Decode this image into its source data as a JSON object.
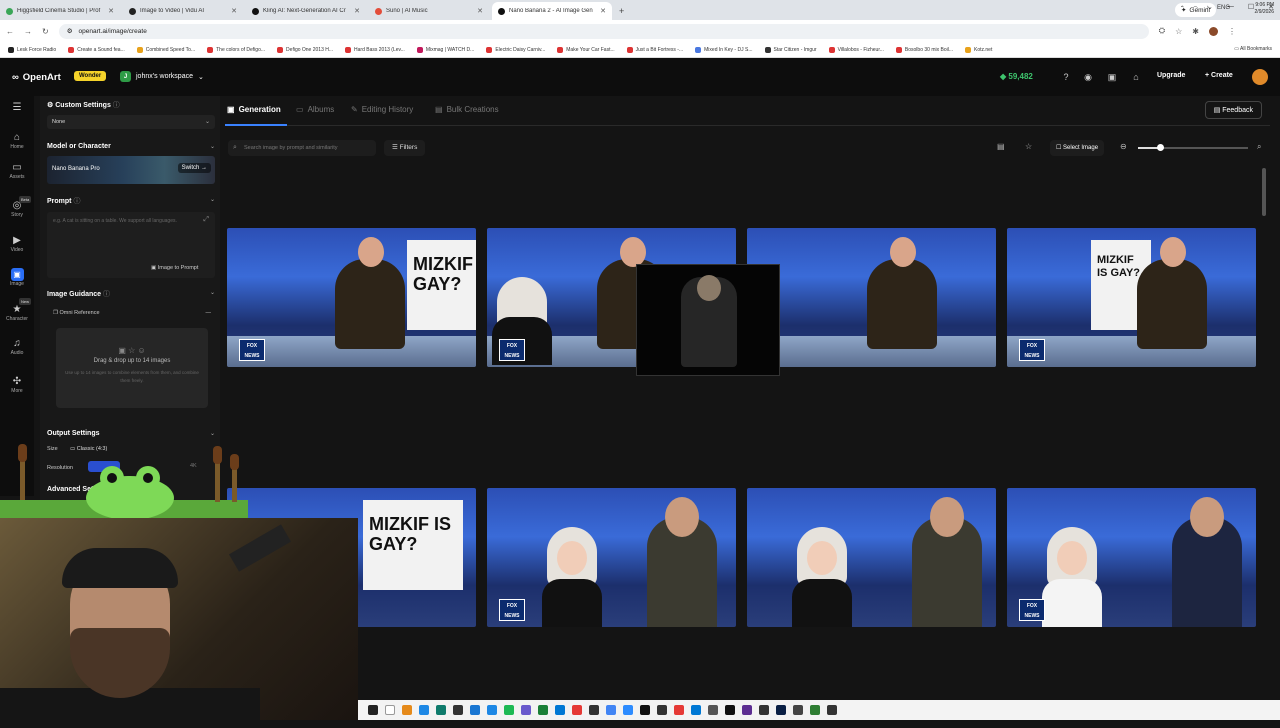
{
  "browser": {
    "tabs": [
      {
        "title": "Higgsfield Cinema Studio | Prof",
        "color": "#3aa657"
      },
      {
        "title": "Image to Video | Vidu AI",
        "color": "#222222"
      },
      {
        "title": "Kling AI: Next-Generation AI Cr",
        "color": "#111111"
      },
      {
        "title": "Suno | AI Music",
        "color": "#e34d3a"
      },
      {
        "title": "Nano Banana 2 - AI Image Gen",
        "color": "#111111",
        "active": true
      }
    ],
    "new_tab": "+",
    "gemini": "Gemini",
    "url": "openart.ai/image/create",
    "bookmarks": [
      "Lesk Force Radio",
      "Create a Sound fea...",
      "Combined Speed To...",
      "The colors of Defigo...",
      "Defigo One 2013 H...",
      "Hard Bass 2013 (Lev...",
      "Mixmag | WATCH D...",
      "Electric Daisy Carniv...",
      "Make Your Car Fast...",
      "Just a Bit Fortress -...",
      "Mixed In Key - DJ S...",
      "Star Citizen - Imgur",
      "Villalobos - Fizheur...",
      "Bosolbo 30 mix Boil...",
      "Kotz.net"
    ],
    "all_bookmarks": "All Bookmarks"
  },
  "header": {
    "logo": "OpenArt",
    "plan_badge": "Wonder",
    "workspace_initial": "J",
    "workspace": "johnx's workspace",
    "credits": "59,482",
    "upgrade": "Upgrade",
    "create": "+ Create"
  },
  "rail": {
    "items": [
      {
        "label": "",
        "icon": "menu-icon"
      },
      {
        "label": "Home",
        "icon": "home-icon"
      },
      {
        "label": "Assets",
        "icon": "folder-icon"
      },
      {
        "label": "Story",
        "icon": "story-icon",
        "badge": "Beta"
      },
      {
        "label": "Video",
        "icon": "video-icon"
      },
      {
        "label": "Image",
        "icon": "image-icon",
        "active": true
      },
      {
        "label": "Character",
        "icon": "character-icon",
        "badge": "New"
      },
      {
        "label": "Audio",
        "icon": "audio-icon"
      },
      {
        "label": "More",
        "icon": "more-icon"
      }
    ]
  },
  "panel": {
    "custom_settings": "Custom Settings",
    "custom_value": "None",
    "model_heading": "Model or Character",
    "model_name": "Nano Banana Pro",
    "switch": "Switch",
    "prompt_heading": "Prompt",
    "prompt_placeholder": "e.g. A cat is sitting on a table. We support all languages.",
    "image_to_prompt": "Image to Prompt",
    "guidance_heading": "Image Guidance",
    "omni": "Omni Reference",
    "drop_title": "Drag & drop up to 14 images",
    "drop_sub": "Use up to 14 images to combine elements from them, and combine them freely.",
    "output_heading": "Output Settings",
    "size_label": "Size",
    "size_value": "Classic (4:3)",
    "resolution_label": "Resolution",
    "res_option": "4K",
    "advanced": "Advanced Settings"
  },
  "main": {
    "tabs": [
      "Generation",
      "Albums",
      "Editing History",
      "Bulk Creations"
    ],
    "feedback": "Feedback",
    "search_placeholder": "Search image by prompt and similarity",
    "filters": "Filters",
    "select_image": "Select Image",
    "zoom_level": 0.2
  },
  "images": {
    "sign_text": "MIZKIF IS GAY?",
    "network_logo": "FOX NEWS"
  },
  "taskbar": {
    "lang": "ENG",
    "time": "9:06 PM",
    "date": "2/9/2026"
  }
}
